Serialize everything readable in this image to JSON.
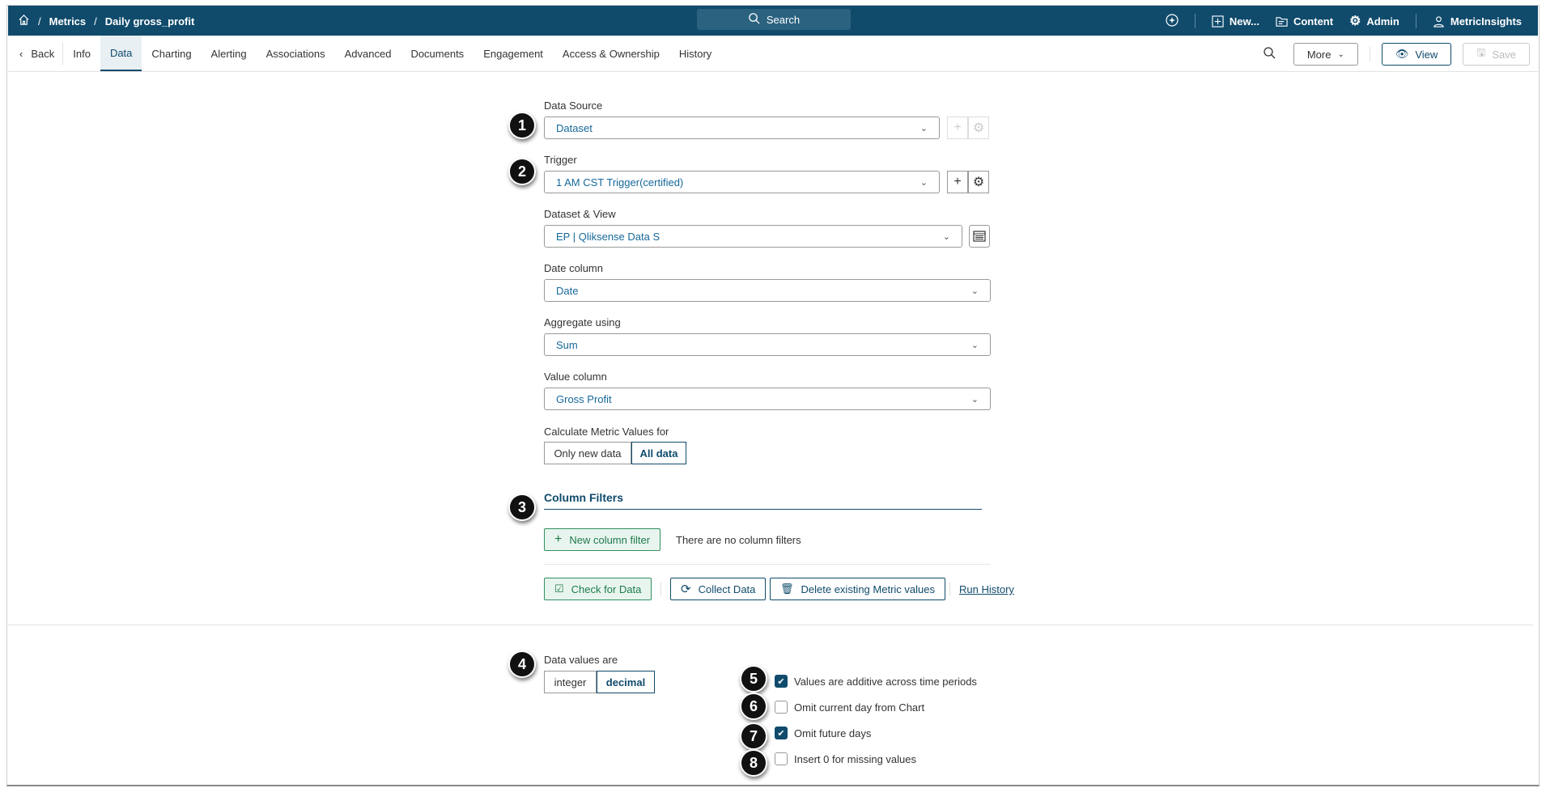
{
  "header": {
    "breadcrumb": [
      "Metrics",
      "Daily gross_profit"
    ],
    "search": "Search",
    "new": "New...",
    "content": "Content",
    "admin": "Admin",
    "user": "MetricInsights"
  },
  "tabs": {
    "back": "Back",
    "items": [
      "Info",
      "Data",
      "Charting",
      "Alerting",
      "Associations",
      "Advanced",
      "Documents",
      "Engagement",
      "Access & Ownership",
      "History"
    ],
    "active": "Data",
    "more": "More",
    "view": "View",
    "save": "Save"
  },
  "form": {
    "data_source": {
      "label": "Data Source",
      "value": "Dataset"
    },
    "trigger": {
      "label": "Trigger",
      "value": "1 AM CST Trigger(certified)"
    },
    "dataset_view": {
      "label": "Dataset & View",
      "value": "EP | Qliksense Data S"
    },
    "date_column": {
      "label": "Date column",
      "value": "Date"
    },
    "aggregate": {
      "label": "Aggregate using",
      "value": "Sum"
    },
    "value_column": {
      "label": "Value column",
      "value": "Gross Profit"
    },
    "calculate": {
      "label": "Calculate Metric Values for",
      "options": [
        "Only new data",
        "All data"
      ],
      "selected": "All data"
    }
  },
  "column_filters": {
    "title": "Column Filters",
    "new_button": "New column filter",
    "empty_text": "There are no column filters"
  },
  "actions": {
    "check": "Check for Data",
    "collect": "Collect Data",
    "delete": "Delete existing Metric values",
    "run_history": "Run History"
  },
  "data_values": {
    "label": "Data values are",
    "options": [
      "integer",
      "decimal"
    ],
    "selected": "decimal"
  },
  "checkboxes": [
    {
      "label": "Values are additive across time periods",
      "checked": true
    },
    {
      "label": "Omit current day from Chart",
      "checked": false
    },
    {
      "label": "Omit future days",
      "checked": true
    },
    {
      "label": "Insert 0 for missing values",
      "checked": false
    }
  ],
  "badges": [
    "1",
    "2",
    "3",
    "4",
    "5",
    "6",
    "7",
    "8"
  ]
}
